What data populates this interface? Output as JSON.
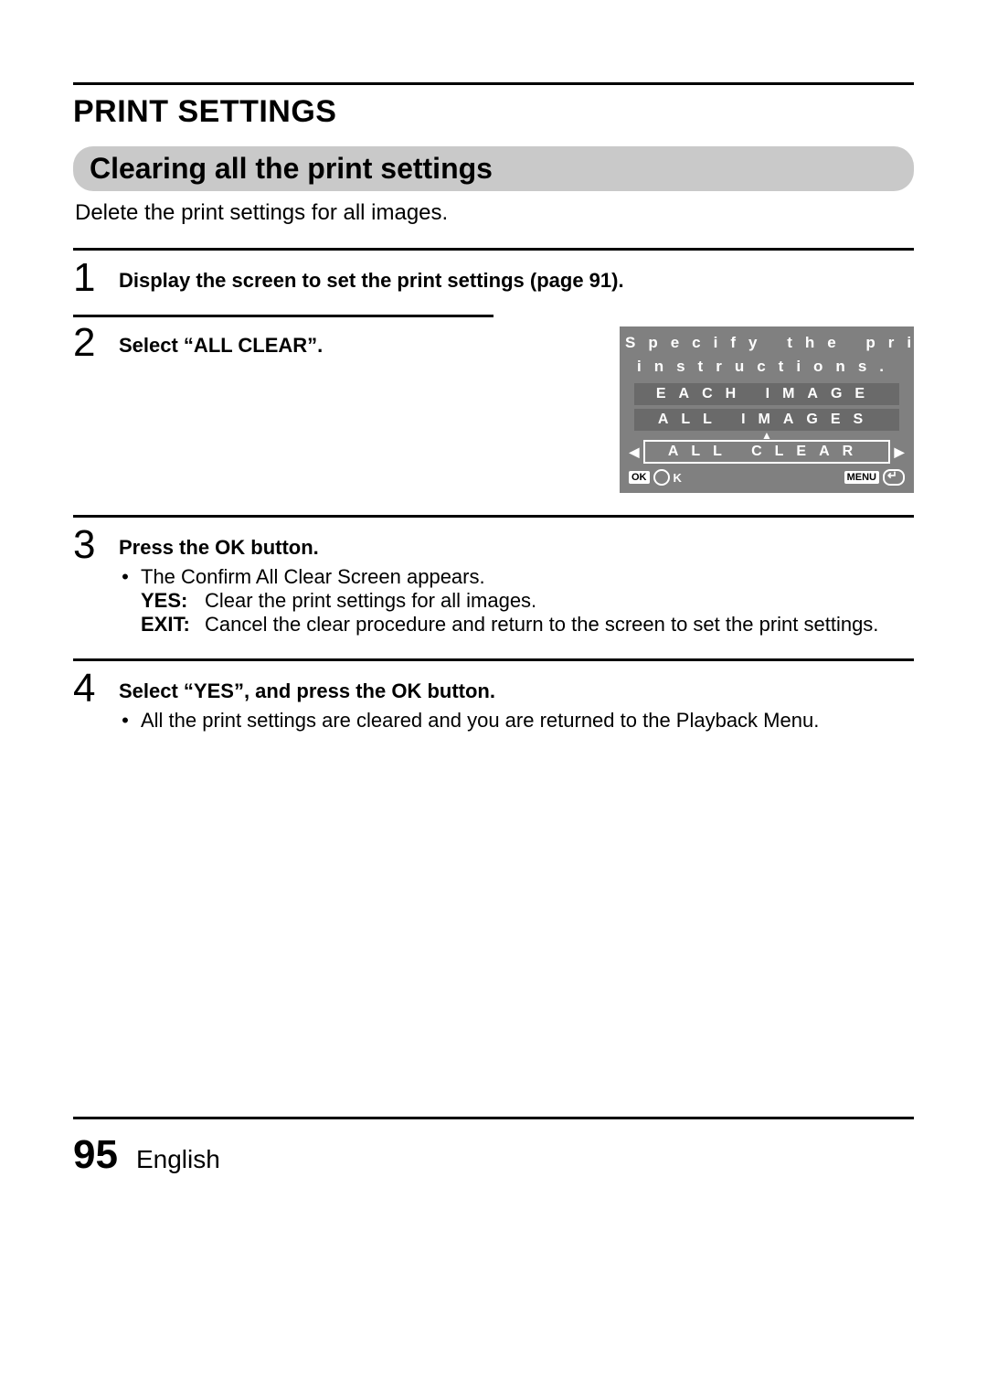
{
  "header": {
    "title": "PRINT SETTINGS"
  },
  "section": {
    "heading": "Clearing all the print settings",
    "intro": "Delete the print settings for all images."
  },
  "steps": {
    "s1": {
      "num": "1",
      "title": "Display the screen to set the print settings (page 91)."
    },
    "s2": {
      "num": "2",
      "title": "Select “ALL CLEAR”."
    },
    "s3": {
      "num": "3",
      "title": "Press the OK button.",
      "bullet": "The Confirm All Clear Screen appears.",
      "yes_label": "YES:",
      "yes_text": "Clear the print settings for all images.",
      "exit_label": "EXIT:",
      "exit_text": "Cancel the clear procedure and return to the screen to set the print settings."
    },
    "s4": {
      "num": "4",
      "title": "Select “YES”, and press the OK button.",
      "bullet": "All the print settings are cleared and you are returned to the Playback Menu."
    }
  },
  "lcd": {
    "title_line1": "Specify the print",
    "title_line2": "instructions.",
    "opt1": "EACH IMAGE",
    "opt2": "ALL IMAGES",
    "opt3_sel": "ALL CLEAR",
    "ok_badge": "OK",
    "ok_letter": "O",
    "ok_after": "K",
    "menu_badge": "MENU"
  },
  "footer": {
    "page": "95",
    "language": "English"
  }
}
